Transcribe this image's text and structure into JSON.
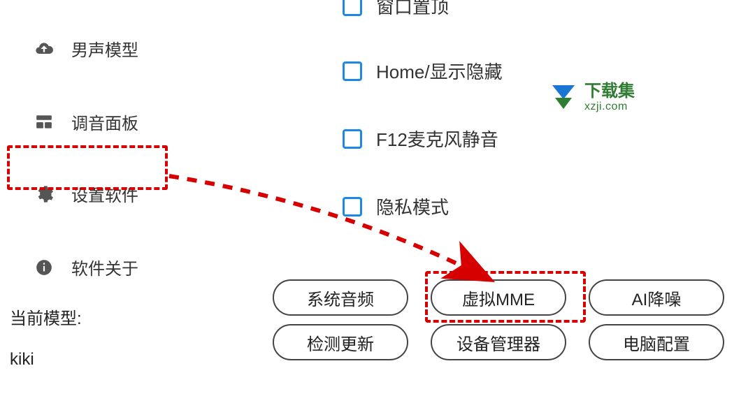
{
  "sidebar": {
    "male_model": "男声模型",
    "tuning_panel": "调音面板",
    "settings": "设置软件",
    "about": "软件关于"
  },
  "model": {
    "label": "当前模型:",
    "name": "kiki"
  },
  "checks": {
    "window_top": "窗口置顶",
    "home_toggle": "Home/显示隐藏",
    "f12_mute": "F12麦克风静音",
    "privacy": "隐私模式"
  },
  "buttons": {
    "system_audio": "系统音频",
    "virtual_mme": "虚拟MME",
    "ai_denoise": "AI降噪",
    "check_update": "检测更新",
    "device_mgr": "设备管理器",
    "pc_config": "电脑配置"
  },
  "watermark": {
    "cn": "下载集",
    "en": "xzji.com"
  }
}
